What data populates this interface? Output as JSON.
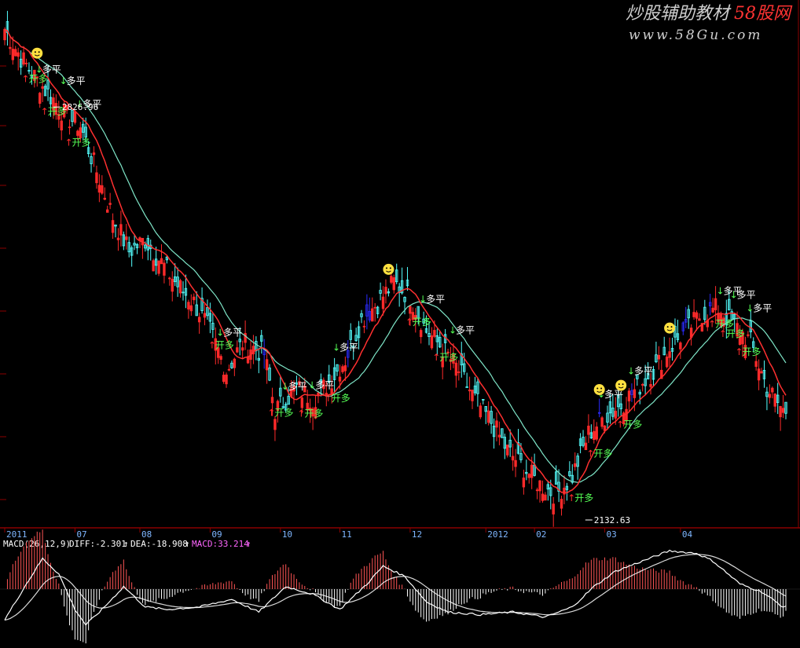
{
  "watermark": {
    "title": "炒股辅助教材",
    "brand": "58股网",
    "url": "www.58Gu.com"
  },
  "colors": {
    "up": "#ff2a2a",
    "down": "#54ffff",
    "hold": "#2b2bff",
    "ma_fast": "#ff3030",
    "ma_slow": "#7fe6c8",
    "buy": "#55ff55",
    "sell": "#ffffff",
    "grid": "#8b0000",
    "macd_pos": "#ff5555",
    "macd_neg": "#ffffff",
    "diff": "#ffffff",
    "dea": "#ffffff",
    "face": "#ffe040"
  },
  "macd_header": {
    "name": "MACD(26,12,9)",
    "diff_label": "DIFF:-2.301",
    "dea_label": "DEA:-18.908",
    "macd_label": "MACD:33.214",
    "arrow": "↑"
  },
  "chart_data": {
    "type": "candlestick",
    "x_ticks": [
      "2011",
      "07",
      "08",
      "09",
      "10",
      "11",
      "12",
      "2012",
      "02",
      "03",
      "04"
    ],
    "price_annotations": [
      {
        "label": "2826.96",
        "type": "high",
        "month": "07"
      },
      {
        "label": "2132.63",
        "type": "low",
        "month": "2012"
      }
    ],
    "price_anchor": {
      "2826.96": 18,
      "2132.63": 58
    },
    "signals": [
      {
        "text": "开多",
        "kind": "buy",
        "at": 8
      },
      {
        "text": "多平",
        "kind": "sell",
        "at": 13
      },
      {
        "text": "开多",
        "kind": "buy",
        "at": 15
      },
      {
        "text": "多平",
        "kind": "sell",
        "at": 22
      },
      {
        "text": "开多",
        "kind": "buy",
        "at": 24
      },
      {
        "text": "多平",
        "kind": "sell",
        "at": 28
      },
      {
        "text": "开多",
        "kind": "buy",
        "at": 77
      },
      {
        "text": "多平",
        "kind": "sell",
        "at": 80
      },
      {
        "text": "开多",
        "kind": "buy",
        "at": 99
      },
      {
        "text": "多平",
        "kind": "sell",
        "at": 104
      },
      {
        "text": "开多",
        "kind": "buy",
        "at": 110
      },
      {
        "text": "多平",
        "kind": "sell",
        "at": 114
      },
      {
        "text": "开多",
        "kind": "buy",
        "at": 120
      },
      {
        "text": "多平",
        "kind": "sell",
        "at": 123
      },
      {
        "text": "开多",
        "kind": "buy",
        "at": 150
      },
      {
        "text": "多平",
        "kind": "sell",
        "at": 155
      },
      {
        "text": "开多",
        "kind": "buy",
        "at": 160
      },
      {
        "text": "多平",
        "kind": "sell",
        "at": 166
      },
      {
        "text": "开多",
        "kind": "buy",
        "at": 210
      },
      {
        "text": "开多",
        "kind": "buy",
        "at": 217
      },
      {
        "text": "多平",
        "kind": "sell",
        "at": 221
      },
      {
        "text": "开多",
        "kind": "buy",
        "at": 228
      },
      {
        "text": "多平",
        "kind": "sell",
        "at": 232
      },
      {
        "text": "开多",
        "kind": "buy",
        "at": 262
      },
      {
        "text": "多平",
        "kind": "sell",
        "at": 265
      },
      {
        "text": "开多",
        "kind": "buy",
        "at": 266
      },
      {
        "text": "多平",
        "kind": "sell",
        "at": 270
      },
      {
        "text": "开多",
        "kind": "buy",
        "at": 272
      },
      {
        "text": "多平",
        "kind": "sell",
        "at": 276
      }
    ],
    "faces": [
      12,
      142,
      220,
      228,
      246
    ],
    "close_path": [
      [
        0,
        2950
      ],
      [
        6,
        2900
      ],
      [
        12,
        2860
      ],
      [
        18,
        2826.96
      ],
      [
        22,
        2800
      ],
      [
        28,
        2780
      ],
      [
        34,
        2700
      ],
      [
        40,
        2620
      ],
      [
        46,
        2560
      ],
      [
        52,
        2580
      ],
      [
        58,
        2540
      ],
      [
        64,
        2500
      ],
      [
        70,
        2470
      ],
      [
        76,
        2420
      ],
      [
        82,
        2350
      ],
      [
        88,
        2400
      ],
      [
        96,
        2380
      ],
      [
        100,
        2280
      ],
      [
        108,
        2320
      ],
      [
        114,
        2300
      ],
      [
        120,
        2330
      ],
      [
        126,
        2370
      ],
      [
        132,
        2440
      ],
      [
        138,
        2470
      ],
      [
        144,
        2505
      ],
      [
        150,
        2480
      ],
      [
        156,
        2420
      ],
      [
        162,
        2390
      ],
      [
        168,
        2350
      ],
      [
        174,
        2300
      ],
      [
        180,
        2260
      ],
      [
        186,
        2210
      ],
      [
        192,
        2180
      ],
      [
        198,
        2150
      ],
      [
        204,
        2132.63
      ],
      [
        210,
        2165
      ],
      [
        216,
        2240
      ],
      [
        222,
        2270
      ],
      [
        228,
        2290
      ],
      [
        234,
        2320
      ],
      [
        240,
        2350
      ],
      [
        246,
        2390
      ],
      [
        252,
        2420
      ],
      [
        258,
        2450
      ],
      [
        264,
        2460
      ],
      [
        270,
        2430
      ],
      [
        276,
        2400
      ],
      [
        282,
        2320
      ],
      [
        288,
        2280
      ]
    ],
    "macd_path": [
      [
        0,
        -60
      ],
      [
        8,
        10
      ],
      [
        14,
        60
      ],
      [
        20,
        30
      ],
      [
        26,
        -40
      ],
      [
        30,
        -70
      ],
      [
        36,
        -40
      ],
      [
        44,
        5
      ],
      [
        52,
        -35
      ],
      [
        60,
        -40
      ],
      [
        72,
        -35
      ],
      [
        84,
        -20
      ],
      [
        94,
        -45
      ],
      [
        104,
        5
      ],
      [
        114,
        -10
      ],
      [
        124,
        -40
      ],
      [
        134,
        10
      ],
      [
        140,
        45
      ],
      [
        148,
        25
      ],
      [
        156,
        -25
      ],
      [
        164,
        -45
      ],
      [
        176,
        -50
      ],
      [
        188,
        -45
      ],
      [
        200,
        -55
      ],
      [
        210,
        -35
      ],
      [
        218,
        5
      ],
      [
        226,
        35
      ],
      [
        236,
        55
      ],
      [
        246,
        75
      ],
      [
        256,
        70
      ],
      [
        262,
        55
      ],
      [
        272,
        10
      ],
      [
        280,
        -5
      ],
      [
        288,
        -35
      ]
    ]
  }
}
